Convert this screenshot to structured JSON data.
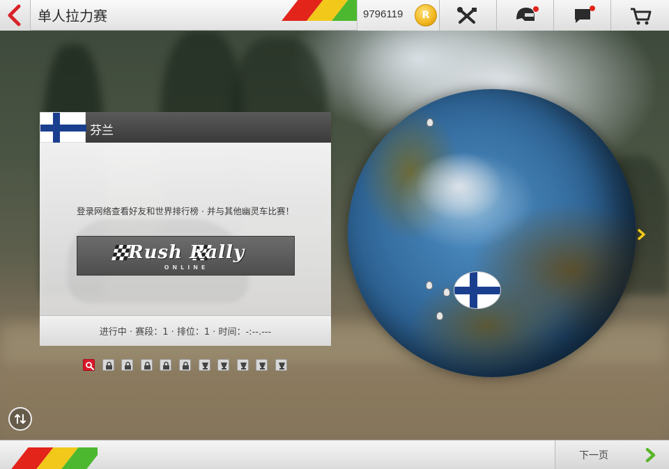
{
  "header": {
    "title": "单人拉力赛",
    "credits": "9796119",
    "coin_symbol": "R"
  },
  "panel": {
    "country": "芬兰",
    "login_message": "登录网络查看好友和世界排行榜 · 并与其他幽灵车比赛！",
    "banner_title": "Rush Rally",
    "banner_subtitle": "ONLINE",
    "progress": "进行中 · 赛段：1 · 排位：1 · 时间：-:--.---"
  },
  "stages": [
    {
      "state": "current",
      "icon": "magnifier-icon"
    },
    {
      "state": "locked",
      "icon": "lock-icon"
    },
    {
      "state": "locked",
      "icon": "lock-icon"
    },
    {
      "state": "locked",
      "icon": "lock-icon"
    },
    {
      "state": "locked",
      "icon": "lock-icon"
    },
    {
      "state": "locked",
      "icon": "lock-icon"
    },
    {
      "state": "locked",
      "icon": "trophy-icon"
    },
    {
      "state": "locked",
      "icon": "trophy-icon"
    },
    {
      "state": "locked",
      "icon": "trophy-icon"
    },
    {
      "state": "locked",
      "icon": "trophy-icon"
    },
    {
      "state": "locked",
      "icon": "trophy-icon"
    }
  ],
  "footer": {
    "next_label": "下一页"
  },
  "colors": {
    "stripe_red": "#e2241b",
    "stripe_yellow": "#f2c81a",
    "stripe_green": "#4cb82f",
    "flag_blue": "#1b3f8f",
    "accent_green": "#5ab52a",
    "accent_yellow": "#f2c81a"
  },
  "icons": {
    "back": "back-arrow-icon",
    "settings": "tools-icon",
    "profile": "helmet-icon",
    "messages": "chat-icon",
    "shop": "cart-icon",
    "swap": "swap-icon",
    "next": "chevron-right-icon"
  }
}
